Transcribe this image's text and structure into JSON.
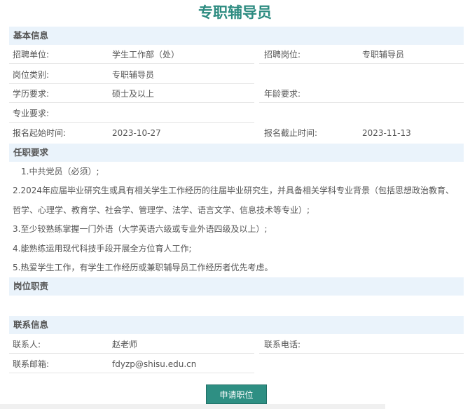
{
  "page_title": "专职辅导员",
  "sections": {
    "basic": "基本信息",
    "requirements": "任职要求",
    "duties": "岗位职责",
    "contact": "联系信息"
  },
  "basic": {
    "unit_label": "招聘单位:",
    "unit_value": "学生工作部（处）",
    "position_label": "招聘岗位:",
    "position_value": "专职辅导员",
    "category_label": "岗位类别:",
    "category_value": "专职辅导员",
    "education_label": "学历要求:",
    "education_value": "硕士及以上",
    "age_label": "年龄要求:",
    "age_value": "",
    "major_label": "专业要求:",
    "major_value": "",
    "start_label": "报名起始时间:",
    "start_value": "2023-10-27",
    "end_label": "报名截止时间:",
    "end_value": "2023-11-13"
  },
  "requirements": [
    "1.中共党员（必须）;",
    "2.2024年应届毕业研究生或具有相关学生工作经历的往届毕业研究生，并具备相关学科专业背景（包括思想政治教育、",
    "哲学、心理学、教育学、社会学、管理学、法学、语言文学、信息技术等专业）;",
    "3.至少较熟练掌握一门外语（大学英语六级或专业外语四级及以上）;",
    "4.能熟练运用现代科技手段开展全方位育人工作;",
    "5.热爱学生工作，有学生工作经历或兼职辅导员工作经历者优先考虑。"
  ],
  "contact": {
    "person_label": "联系人:",
    "person_value": "赵老师",
    "phone_label": "联系电话:",
    "phone_value": "",
    "email_label": "联系邮箱:",
    "email_value": "fdyzp@shisu.edu.cn"
  },
  "apply_button": "申请职位"
}
